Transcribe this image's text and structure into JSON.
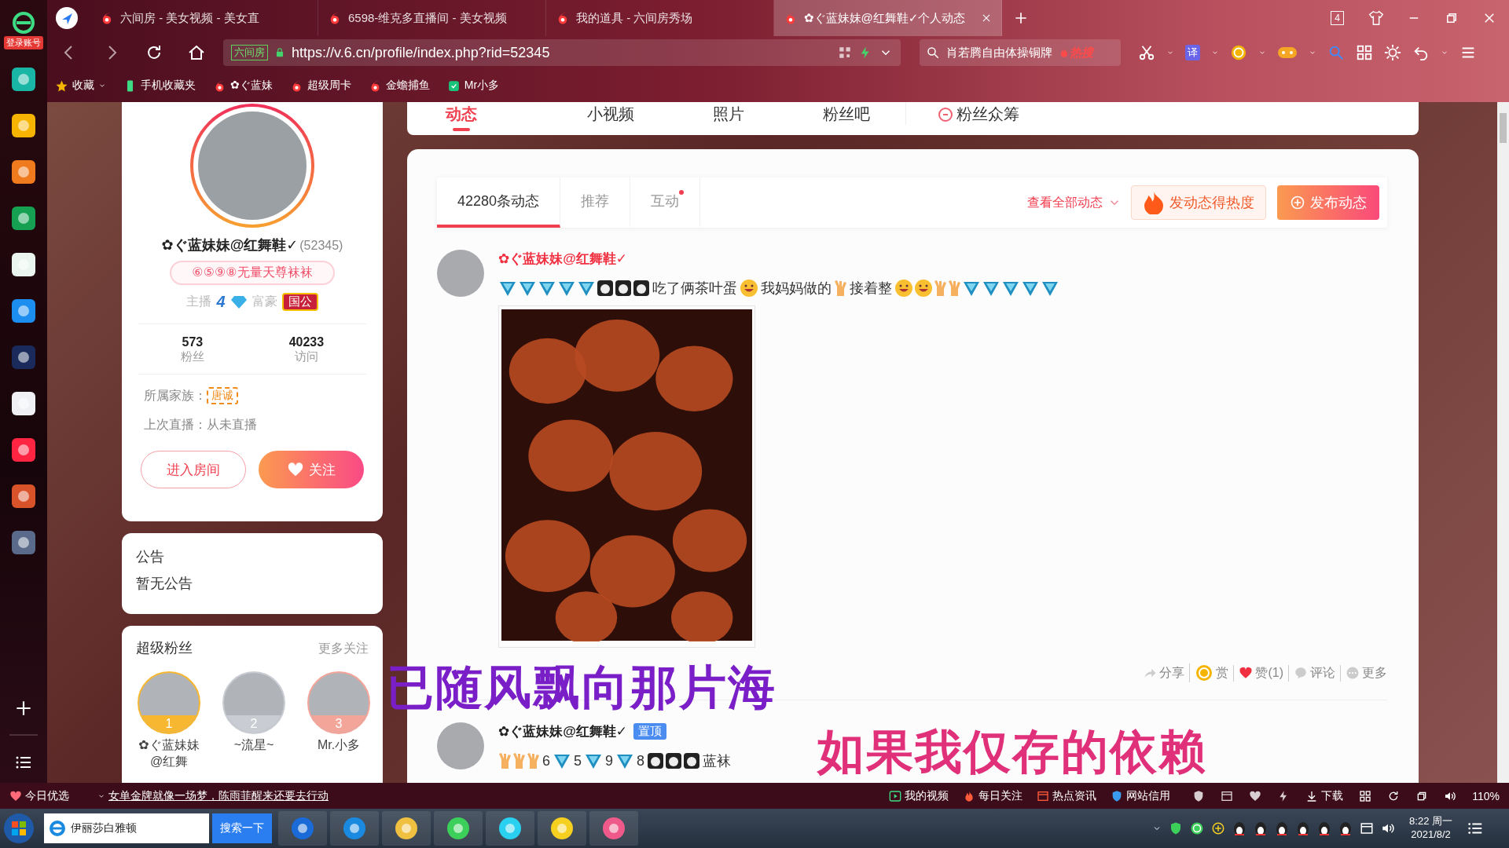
{
  "browser": {
    "tabs": [
      {
        "title": "六间房 - 美女视频 - 美女直",
        "selected": false
      },
      {
        "title": "6598-维克多直播间 - 美女视频",
        "selected": false
      },
      {
        "title": "我的道具 - 六间房秀场",
        "selected": false
      },
      {
        "title": "✿ぐ蓝妹妹@红舞鞋✓个人动态",
        "selected": true
      }
    ],
    "window_count": "4",
    "address_tag": "六间房",
    "url": "https://v.6.cn/profile/index.php?rid=52345",
    "search": {
      "value": "肖若腾自由体操铜牌",
      "hot_label": "热搜"
    },
    "translate_label": "译",
    "bookmarks": [
      {
        "label": "收藏",
        "kind": "star"
      },
      {
        "label": "手机收藏夹",
        "kind": "phone"
      },
      {
        "label": "✿ぐ蓝妹",
        "kind": "site"
      },
      {
        "label": "超级周卡",
        "kind": "site"
      },
      {
        "label": "金蟾捕鱼",
        "kind": "site"
      },
      {
        "label": "Mr小多",
        "kind": "app"
      }
    ]
  },
  "dock": {
    "login_badge": "登录账号"
  },
  "profile_nav": [
    {
      "label": "动态",
      "selected": true,
      "kind": "plain"
    },
    {
      "label": "小视频",
      "selected": false,
      "kind": "plain"
    },
    {
      "label": "照片",
      "selected": false,
      "kind": "plain"
    },
    {
      "label": "粉丝吧",
      "selected": false,
      "kind": "plain"
    },
    {
      "label": "粉丝众筹",
      "selected": false,
      "kind": "badge"
    }
  ],
  "profile": {
    "name": "✿ぐ蓝妹妹@红舞鞋✓",
    "room_id": "(52345)",
    "title_badge": "⑥⑤⑨⑧无量天尊袜袜",
    "anchor_label": "主播",
    "anchor_level": "4",
    "wealth_label": "富豪",
    "wealth_badge": "国公",
    "stats": [
      {
        "value": "573",
        "label": "粉丝"
      },
      {
        "value": "40233",
        "label": "访问"
      }
    ],
    "family_label": "所属家族：",
    "family_tag": "唐诚",
    "last_live": "上次直播：从未直播",
    "enter_button": "进入房间",
    "follow_button": "关注"
  },
  "announcement": {
    "title": "公告",
    "text": "暂无公告"
  },
  "super_fans": {
    "title": "超级粉丝",
    "more": "更多关注",
    "fans": [
      {
        "rank": "1",
        "name": "✿ぐ蓝妹妹@红舞",
        "color": "#f7b731"
      },
      {
        "rank": "2",
        "name": "~流星~",
        "color": "#c9ccd2"
      },
      {
        "rank": "3",
        "name": "Mr.小多",
        "color": "#f4a59a"
      }
    ]
  },
  "feed": {
    "tabs": [
      {
        "label": "42280条动态",
        "selected": true,
        "dot": false
      },
      {
        "label": "推荐",
        "selected": false,
        "dot": false
      },
      {
        "label": "互动",
        "selected": false,
        "dot": true
      }
    ],
    "filter": "查看全部动态",
    "heat_button": "发动态得热度",
    "publish_button": "发布动态",
    "posts": [
      {
        "author": "✿ぐ蓝妹妹@红舞鞋✓",
        "highlighted": true,
        "photo": true,
        "content": [
          {
            "kind": "badge"
          },
          {
            "kind": "badge"
          },
          {
            "kind": "badge"
          },
          {
            "kind": "badge"
          },
          {
            "kind": "badge"
          },
          {
            "kind": "sticker"
          },
          {
            "kind": "sticker"
          },
          {
            "kind": "sticker"
          },
          {
            "kind": "text",
            "text": "吃了俩茶叶蛋"
          },
          {
            "kind": "smiley"
          },
          {
            "kind": "text",
            "text": "我妈妈做的"
          },
          {
            "kind": "hand"
          },
          {
            "kind": "text",
            "text": "接着整"
          },
          {
            "kind": "smiley"
          },
          {
            "kind": "smiley"
          },
          {
            "kind": "hand"
          },
          {
            "kind": "hand"
          },
          {
            "kind": "badge"
          },
          {
            "kind": "badge"
          },
          {
            "kind": "badge"
          },
          {
            "kind": "badge"
          },
          {
            "kind": "badge"
          }
        ],
        "actions": [
          {
            "label": "分享",
            "kind": "share"
          },
          {
            "label": "赏",
            "kind": "reward"
          },
          {
            "label": "赞(1)",
            "kind": "like"
          },
          {
            "label": "评论",
            "kind": "comment"
          },
          {
            "label": "更多",
            "kind": "more"
          }
        ]
      },
      {
        "author": "✿ぐ蓝妹妹@红舞鞋✓",
        "highlighted": false,
        "photo": false,
        "badge": "置顶",
        "content": [
          {
            "kind": "hand"
          },
          {
            "kind": "hand"
          },
          {
            "kind": "hand"
          },
          {
            "kind": "text",
            "text": "6"
          },
          {
            "kind": "badge"
          },
          {
            "kind": "text",
            "text": "5"
          },
          {
            "kind": "badge"
          },
          {
            "kind": "text",
            "text": "9"
          },
          {
            "kind": "badge"
          },
          {
            "kind": "text",
            "text": "8"
          },
          {
            "kind": "sticker"
          },
          {
            "kind": "sticker"
          },
          {
            "kind": "sticker"
          },
          {
            "kind": "text",
            "text": "蓝袜"
          }
        ]
      }
    ]
  },
  "lyrics": [
    {
      "text": "已随风飘向那片海"
    },
    {
      "text": "如果我仅存的依赖"
    }
  ],
  "status_bar": {
    "today_label": "今日优选",
    "headline": "女单金牌就像一场梦，陈雨菲醒来还要去行动",
    "links": [
      {
        "label": "我的视频"
      },
      {
        "label": "每日关注"
      },
      {
        "label": "热点资讯"
      },
      {
        "label": "网站信用"
      }
    ],
    "download": "下载",
    "zoom": "110%"
  },
  "taskbar": {
    "search_value": "伊丽莎白雅顿",
    "search_button": "搜索一下",
    "time": "8:22 周一",
    "date": "2021/8/2"
  }
}
